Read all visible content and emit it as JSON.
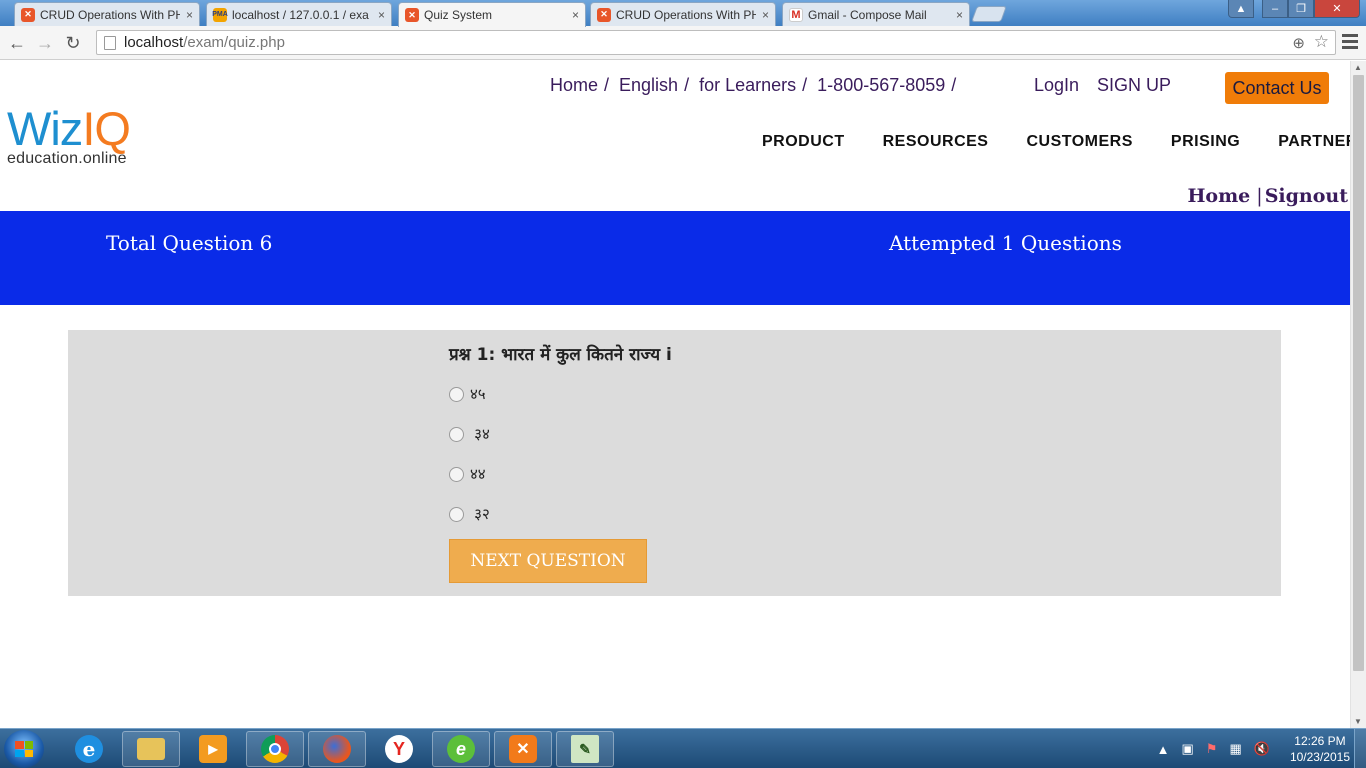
{
  "browser": {
    "tabs": [
      {
        "title": "CRUD Operations With PH",
        "icon": "xampp-icon",
        "active": false
      },
      {
        "title": "localhost / 127.0.0.1 / exa",
        "icon": "phpmyadmin-icon",
        "active": false
      },
      {
        "title": "Quiz System",
        "icon": "xampp-icon",
        "active": true
      },
      {
        "title": "CRUD Operations With PH",
        "icon": "xampp-icon",
        "active": false
      },
      {
        "title": "Gmail - Compose Mail",
        "icon": "gmail-icon",
        "active": false
      }
    ],
    "url_host": "localhost",
    "url_path": "/exam/quiz.php",
    "close_glyph": "×"
  },
  "site": {
    "topnav": [
      "Home",
      "English",
      "for Learners",
      "1-800-567-8059"
    ],
    "topnav_sep": "/",
    "login": "LogIn",
    "signup": "SIGN UP",
    "contact": "Contact Us",
    "logo_wiz": "Wiz",
    "logo_iq": "IQ",
    "logo_tag": "education.online",
    "mainnav": [
      "PRODUCT",
      "RESOURCES",
      "CUSTOMERS",
      "PRISING",
      "PARTNERS"
    ],
    "user_home": "Home",
    "user_sep": "|",
    "user_signout": "Signout"
  },
  "banner": {
    "total": "Total Question 6",
    "attempted": "Attempted 1 Questions",
    "color": "#0a2be8"
  },
  "quiz": {
    "question": "प्रश्न 1: भारत में कुल कितने राज्य i",
    "options": [
      "४५",
      " ३४",
      "४४",
      " ३२"
    ],
    "next_label": "NEXT QUESTION"
  },
  "taskbar": {
    "time": "12:26 PM",
    "date": "10/23/2015",
    "apps": [
      "ie-icon",
      "explorer-icon",
      "media-player-icon",
      "chrome-icon",
      "firefox-icon",
      "yandex-icon",
      "dreamweaver-icon",
      "xampp-icon",
      "notepad-icon"
    ]
  },
  "colors": {
    "contact_button": "#f07c08",
    "next_button": "#efac4e",
    "quiz_box": "#dcdcdc",
    "nav_text": "#3a1c5c"
  }
}
